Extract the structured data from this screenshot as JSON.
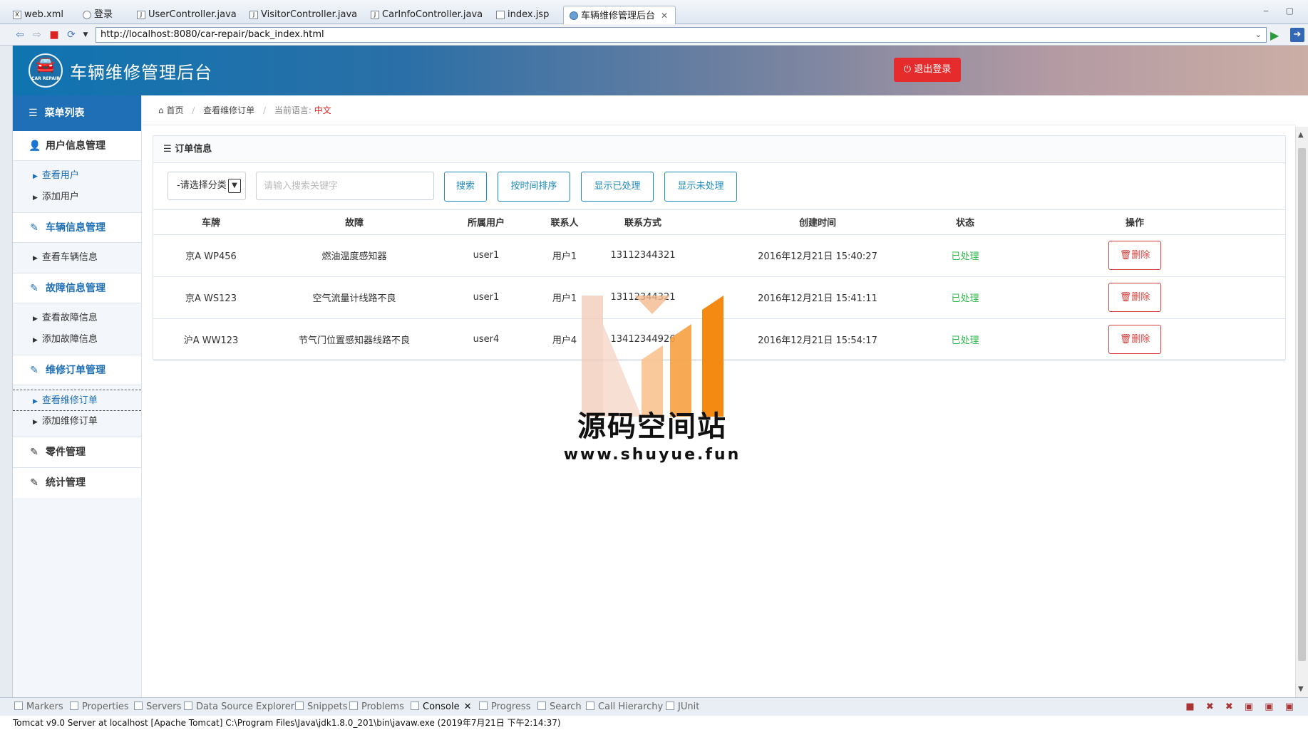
{
  "ide": {
    "tabs": [
      {
        "label": "web.xml"
      },
      {
        "label": "登录"
      },
      {
        "label": "UserController.java"
      },
      {
        "label": "VisitorController.java"
      },
      {
        "label": "CarInfoController.java"
      },
      {
        "label": "index.jsp"
      },
      {
        "label": "车辆维修管理后台",
        "active": true
      }
    ],
    "url": "http://localhost:8080/car-repair/back_index.html",
    "bottom_tabs": [
      "Markers",
      "Properties",
      "Servers",
      "Data Source Explorer",
      "Snippets",
      "Problems",
      "Console",
      "Progress",
      "Search",
      "Call Hierarchy",
      "JUnit"
    ],
    "active_bottom_tab": "Console",
    "console_status": "Tomcat v9.0 Server at localhost [Apache Tomcat] C:\\Program Files\\Java\\jdk1.8.0_201\\bin\\javaw.exe (2019年7月21日 下午2:14:37)"
  },
  "app": {
    "title": "车辆维修管理后台",
    "logo_sub": "CAR REPAIR",
    "logout_label": "退出登录",
    "accent": "#1e6fb5",
    "danger": "#e52b2b"
  },
  "sidebar": {
    "header": "菜单列表",
    "groups": [
      {
        "title": "用户信息管理",
        "icon": "user-icon",
        "items": [
          "查看用户",
          "添加用户"
        ],
        "active_item": 0
      },
      {
        "title": "车辆信息管理",
        "icon": "edit-icon",
        "items": [
          "查看车辆信息"
        ]
      },
      {
        "title": "故障信息管理",
        "icon": "edit-icon",
        "items": [
          "查看故障信息",
          "添加故障信息"
        ]
      },
      {
        "title": "维修订单管理",
        "icon": "edit-icon",
        "items": [
          "查看维修订单",
          "添加维修订单"
        ],
        "active_item": 0
      },
      {
        "title": "零件管理",
        "icon": "edit-icon",
        "items": []
      },
      {
        "title": "统计管理",
        "icon": "edit-icon",
        "items": []
      }
    ]
  },
  "breadcrumb": {
    "home": "首页",
    "current": "查看维修订单",
    "lang_label": "当前语言:",
    "lang_value": "中文"
  },
  "panel": {
    "title": "订单信息",
    "select_value": "-请选择分类-",
    "search_placeholder": "请输入搜索关键字",
    "buttons": {
      "search": "搜索",
      "sort_time": "按时间排序",
      "show_done": "显示已处理",
      "show_pending": "显示未处理"
    },
    "columns": [
      "车牌",
      "故障",
      "所属用户",
      "联系人",
      "联系方式",
      "创建时间",
      "状态",
      "操作"
    ],
    "rows": [
      {
        "plate": "京A WP456",
        "fault": "燃油温度感知器",
        "user": "user1",
        "contact": "用户1",
        "phone": "13112344321",
        "created": "2016年12月21日 15:40:27",
        "status": "已处理"
      },
      {
        "plate": "京A WS123",
        "fault": "空气流量计线路不良",
        "user": "user1",
        "contact": "用户1",
        "phone": "13112344321",
        "created": "2016年12月21日 15:41:11",
        "status": "已处理"
      },
      {
        "plate": "沪A WW123",
        "fault": "节气门位置感知器线路不良",
        "user": "user4",
        "contact": "用户4",
        "phone": "13412344926",
        "created": "2016年12月21日 15:54:17",
        "status": "已处理"
      }
    ],
    "delete_label": "删除"
  },
  "watermark": {
    "text": "源码空间站",
    "url": "www.shuyue.fun"
  }
}
